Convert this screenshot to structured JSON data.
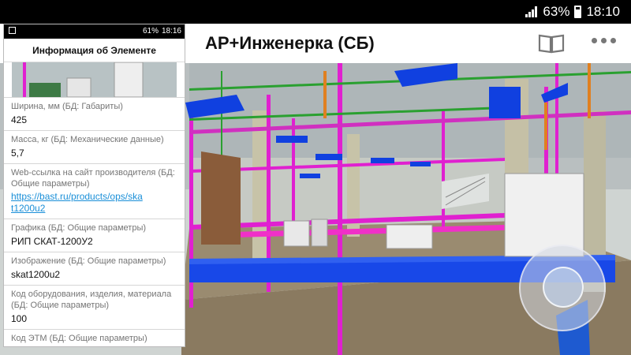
{
  "status_bar": {
    "battery": "63%",
    "time": "18:10"
  },
  "mini_status_bar": {
    "battery": "61%",
    "time": "18:16"
  },
  "app_bar": {
    "title": "АР+Инженерка (СБ)"
  },
  "info_panel": {
    "title": "Информация об Элементе",
    "fields": [
      {
        "label": "Ширина, мм (БД: Габариты)",
        "value": "425"
      },
      {
        "label": "Масса, кг (БД: Механические данные)",
        "value": "5,7"
      },
      {
        "label": "Web-ссылка на сайт производителя (БД: Общие параметры)",
        "value": "https://bast.ru/products/ops/skat1200u2"
      },
      {
        "label": "Графика (БД: Общие параметры)",
        "value": "РИП СКАТ-1200У2"
      },
      {
        "label": "Изображение (БД: Общие параметры)",
        "value": "skat1200u2"
      },
      {
        "label": "Код оборудования, изделия, материала (БД: Общие параметры)",
        "value": "100"
      },
      {
        "label": "Код ЭТМ (БД: Общие параметры)",
        "value": ""
      }
    ]
  },
  "colors": {
    "pipe_magenta": "#e020d0",
    "duct_blue": "#1040e0",
    "floor_brown": "#8a7a60",
    "link": "#1a8fd8"
  }
}
